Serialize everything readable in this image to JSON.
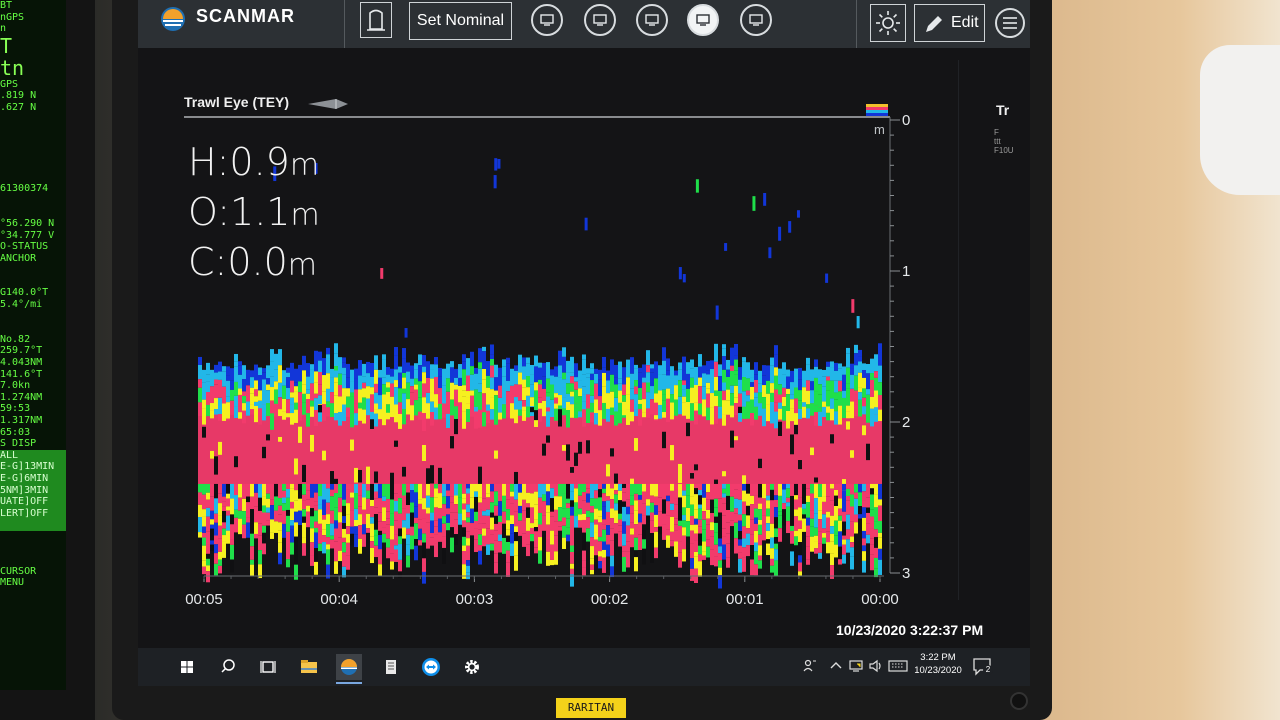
{
  "app": {
    "brand": "SCANMAR"
  },
  "toolbar": {
    "set_nominal_label": "Set Nominal",
    "edit_label": "Edit",
    "view_buttons": [
      "view-1",
      "view-2",
      "view-3",
      "view-4",
      "view-5"
    ],
    "active_view_index": 3,
    "accent": "#2c3034"
  },
  "panel": {
    "title": "Trawl Eye (TEY)",
    "right_title": "Tr",
    "right_tiny_lines": [
      "F",
      "ttt",
      "F10U"
    ],
    "readouts": [
      {
        "key": "H:",
        "value": "0.9",
        "unit": "m"
      },
      {
        "key": "O:",
        "value": "1.1",
        "unit": "m"
      },
      {
        "key": "C:",
        "value": "0.0",
        "unit": "m"
      }
    ],
    "y_unit": "m"
  },
  "chart_data": {
    "type": "heatmap",
    "title": "Trawl Eye (TEY)",
    "y_ticks": [
      "0",
      "1",
      "2",
      "3"
    ],
    "ylim": [
      0,
      3
    ],
    "x_ticks": [
      "00:05",
      "00:04",
      "00:03",
      "00:02",
      "00:01",
      "00:00"
    ],
    "xlim": [
      "00:05",
      "00:00"
    ],
    "y_unit": "m",
    "echo_band_top_m": 1.45,
    "echo_band_bottom_m": 2.95,
    "dense_core_top_m": 1.75,
    "dense_core_bottom_m": 2.45,
    "palette": [
      "#1236d8",
      "#22b7e8",
      "#1fdf4a",
      "#f6f020",
      "#f23b6c"
    ]
  },
  "status": {
    "datetime": "10/23/2020 3:22:37 PM"
  },
  "taskbar": {
    "apps": [
      "windows-start",
      "search",
      "task-view",
      "file-explorer",
      "scanmar-app",
      "app-list",
      "teamviewer",
      "settings"
    ],
    "clock_time": "3:22 PM",
    "clock_date": "10/23/2020",
    "notification_count": "2"
  },
  "left_monitor": {
    "lines": [
      "BT",
      "nGPS",
      "n",
      "T",
      "tn",
      "GPS",
      ".819 N",
      ".627 N",
      "",
      "",
      "",
      "",
      "",
      "",
      "61300374",
      "",
      "",
      "°56.290 N",
      "°34.777 V",
      "O-STATUS",
      " ANCHOR",
      "",
      "",
      "G140.0°T",
      " 5.4°/mi",
      "",
      "",
      " No.82",
      " 259.7°T",
      " 4.043NM",
      " 141.6°T",
      "   7.0kn",
      " 1.274NM",
      "  59:53",
      " 1.317NM",
      "  65:03",
      "S DISP",
      " ALL ",
      "E-G]13MIN",
      "E-G]6MIN",
      "5NM]3MIN",
      "UATE]OFF",
      "LERT]OFF",
      "",
      "",
      "",
      "",
      "CURSOR",
      "   MENU"
    ]
  },
  "hardware": {
    "monitor_label": "RARITAN"
  }
}
